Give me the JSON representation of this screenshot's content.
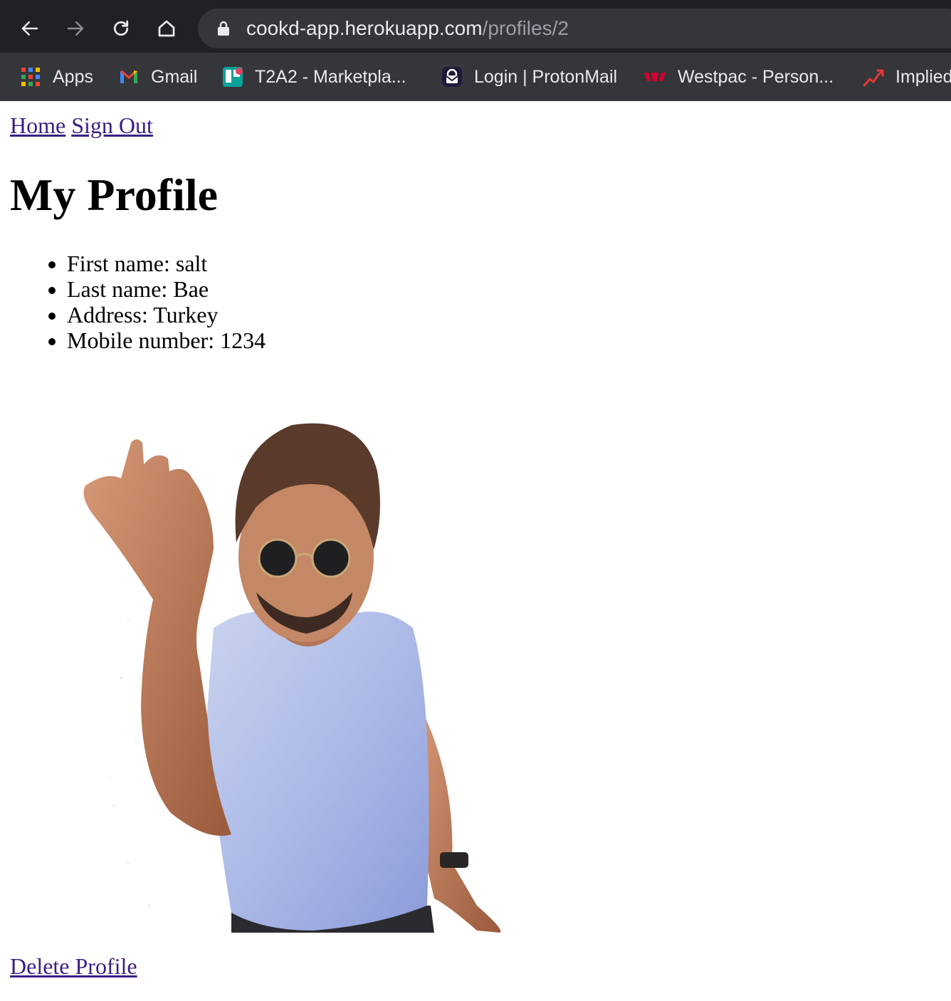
{
  "browser": {
    "url_host": "cookd-app.herokuapp.com",
    "url_path": "/profiles/2",
    "bookmarks": [
      {
        "label": "Apps",
        "icon": "apps-grid-icon"
      },
      {
        "label": "Gmail",
        "icon": "gmail-icon"
      },
      {
        "label": "T2A2 - Marketpla...",
        "icon": "trello-icon"
      },
      {
        "label": "Login | ProtonMail",
        "icon": "protonmail-icon"
      },
      {
        "label": "Westpac - Person...",
        "icon": "westpac-icon"
      },
      {
        "label": "Implied",
        "icon": "chart-trend-icon"
      }
    ]
  },
  "nav": {
    "home": "Home",
    "sign_out": "Sign Out"
  },
  "page": {
    "title": "My Profile",
    "details": [
      "First name: salt",
      "Last name: Bae",
      "Address: Turkey",
      "Mobile number: 1234"
    ],
    "delete_label": "Delete Profile"
  },
  "colors": {
    "link": "#3b1f86",
    "chrome_dark": "#202124",
    "chrome_bar": "#35363a",
    "westpac_red": "#d5002b"
  }
}
